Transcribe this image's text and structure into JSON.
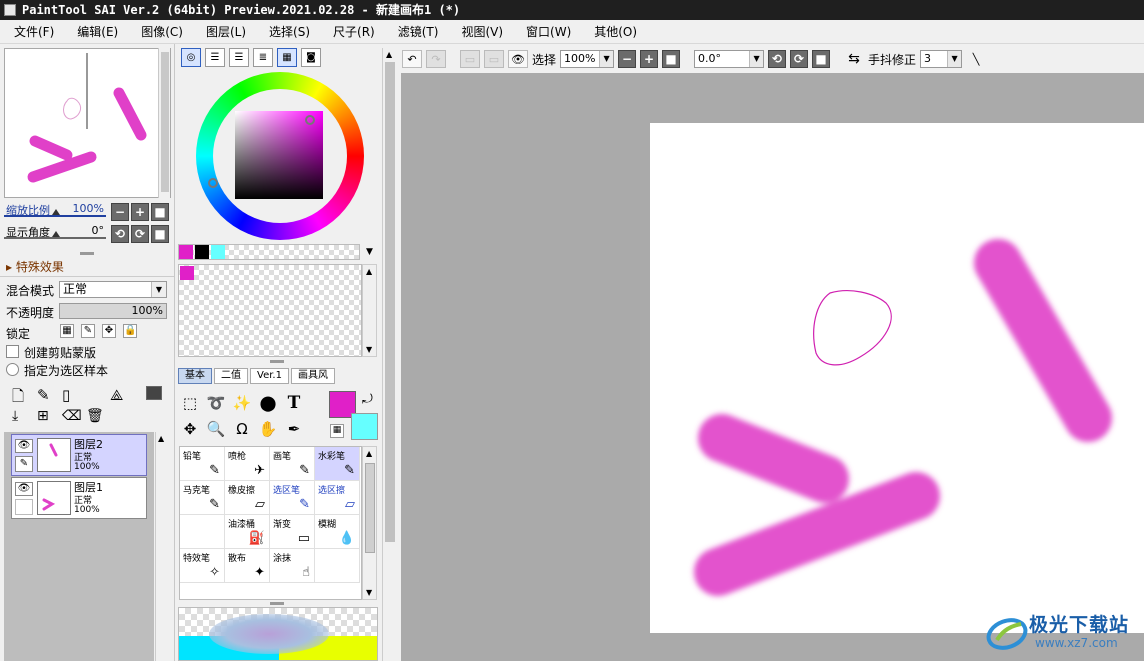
{
  "window": {
    "title": "PaintTool SAI Ver.2 (64bit) Preview.2021.02.28 - 新建画布1 (*)"
  },
  "menu": [
    "文件(F)",
    "编辑(E)",
    "图像(C)",
    "图层(L)",
    "选择(S)",
    "尺子(R)",
    "滤镜(T)",
    "视图(V)",
    "窗口(W)",
    "其他(O)"
  ],
  "navigator": {
    "zoom_label": "缩放比例",
    "zoom_value": "100%",
    "angle_label": "显示角度",
    "angle_value": "0°"
  },
  "layer_props": {
    "section": "特殊效果",
    "blend_label": "混合模式",
    "blend_value": "正常",
    "opacity_label": "不透明度",
    "opacity_value": "100%",
    "lock_label": "锁定",
    "clip_label": "创建剪贴蒙版",
    "select_src_label": "指定为选区样本"
  },
  "layers": [
    {
      "name": "图层2",
      "mode": "正常",
      "opacity": "100%",
      "selected": true
    },
    {
      "name": "图层1",
      "mode": "正常",
      "opacity": "100%",
      "selected": false
    }
  ],
  "color": {
    "primary": "#e020c8",
    "secondary": "#66ffff",
    "swatches": [
      "#e020c8",
      "#000000",
      "#66ffff"
    ]
  },
  "tool_tabs": [
    "基本",
    "二值",
    "Ver.1",
    "画具风"
  ],
  "brushes": [
    {
      "label": "铅笔",
      "icon": "✎",
      "blue": false,
      "sel": false
    },
    {
      "label": "喷枪",
      "icon": "✈",
      "blue": false,
      "sel": false
    },
    {
      "label": "画笔",
      "icon": "✎",
      "blue": false,
      "sel": false
    },
    {
      "label": "水彩笔",
      "icon": "✎",
      "blue": false,
      "sel": true
    },
    {
      "label": "马克笔",
      "icon": "✎",
      "blue": false,
      "sel": false
    },
    {
      "label": "橡皮擦",
      "icon": "▱",
      "blue": false,
      "sel": false
    },
    {
      "label": "选区笔",
      "icon": "✎",
      "blue": true,
      "sel": false
    },
    {
      "label": "选区擦",
      "icon": "▱",
      "blue": true,
      "sel": false
    },
    {
      "label": "",
      "icon": "",
      "blue": false,
      "sel": false
    },
    {
      "label": "油漆桶",
      "icon": "⛽",
      "blue": false,
      "sel": false
    },
    {
      "label": "渐变",
      "icon": "▭",
      "blue": false,
      "sel": false
    },
    {
      "label": "模糊",
      "icon": "💧",
      "blue": false,
      "sel": false
    },
    {
      "label": "特效笔",
      "icon": "✧",
      "blue": false,
      "sel": false
    },
    {
      "label": "散布",
      "icon": "✦",
      "blue": false,
      "sel": false
    },
    {
      "label": "涂抹",
      "icon": "☝",
      "blue": false,
      "sel": false
    },
    {
      "label": "",
      "icon": "",
      "blue": false,
      "sel": false
    }
  ],
  "toolbar": {
    "select_label": "选择",
    "zoom": "100%",
    "rotation": "0.0°",
    "stabilizer_label": "手抖修正",
    "stabilizer_value": "3"
  },
  "watermark": {
    "line1": "极光下载站",
    "line2": "www.xz7.com"
  }
}
